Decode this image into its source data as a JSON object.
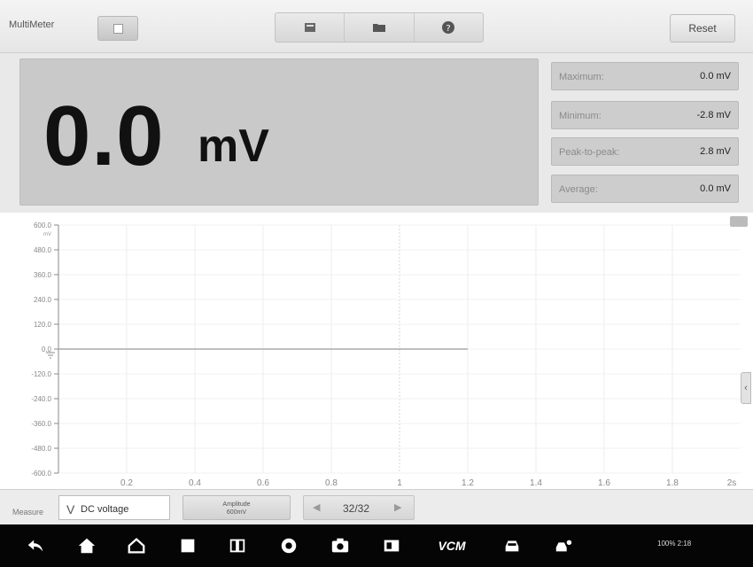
{
  "app": {
    "title": "MultiMeter"
  },
  "toolbar": {
    "reset_label": "Reset"
  },
  "reading": {
    "value": "0.0",
    "unit": "mV"
  },
  "stats": [
    {
      "label": "Maximum:",
      "value": "0.0 mV"
    },
    {
      "label": "Minimum:",
      "value": "-2.8 mV"
    },
    {
      "label": "Peak-to-peak:",
      "value": "2.8 mV"
    },
    {
      "label": "Average:",
      "value": "0.0 mV"
    }
  ],
  "chart_data": {
    "type": "line",
    "yunit": "mV",
    "ylim": [
      -600,
      600
    ],
    "xlim": [
      0,
      2
    ],
    "yticks": [
      "600.0",
      "480.0",
      "360.0",
      "240.0",
      "120.0",
      "0.0",
      "-120.0",
      "-240.0",
      "-360.0",
      "-480.0",
      "-600.0"
    ],
    "xticks": [
      "0.2",
      "0.4",
      "0.6",
      "0.8",
      "1",
      "1.2",
      "1.4",
      "1.6",
      "1.8",
      "2s"
    ],
    "series": [
      {
        "x": [
          0,
          0.5,
          1.0,
          1.2
        ],
        "y": [
          0,
          0,
          0,
          0
        ]
      }
    ],
    "grid": true
  },
  "measure": {
    "label": "Measure",
    "value": "DC voltage",
    "amp_line1": "Amplitude",
    "amp_line2": "600mV"
  },
  "pager": {
    "count": "32/32"
  },
  "navbar": {
    "vcm_label": "VCM",
    "status_text": "100% 2:18"
  }
}
